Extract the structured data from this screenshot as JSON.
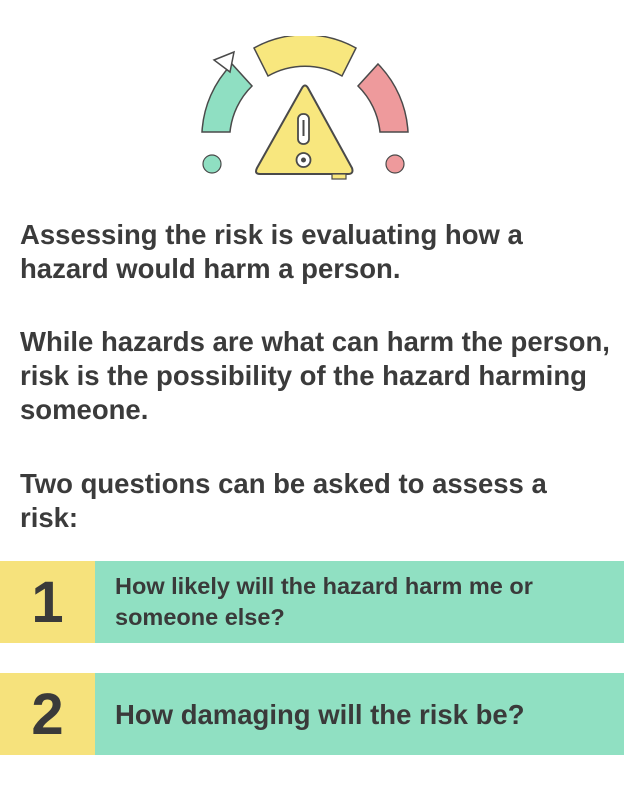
{
  "paragraphs": {
    "p1": "Assessing the risk is evaluating how a hazard would harm a person.",
    "p2": "While hazards are what can harm the person, risk is the possibility of the hazard harming someone.",
    "p3": "Two questions can be asked to assess a risk:"
  },
  "questions": [
    {
      "number": "1",
      "text": "How likely will the hazard harm me or someone else?"
    },
    {
      "number": "2",
      "text": "How damaging will the risk be?"
    }
  ],
  "illustration": {
    "icon": "risk-gauge-warning-icon",
    "colors": {
      "green": "#8fdfc2",
      "yellow": "#f8e77e",
      "red": "#ee9a9c",
      "outline": "#4a4a4a"
    }
  }
}
